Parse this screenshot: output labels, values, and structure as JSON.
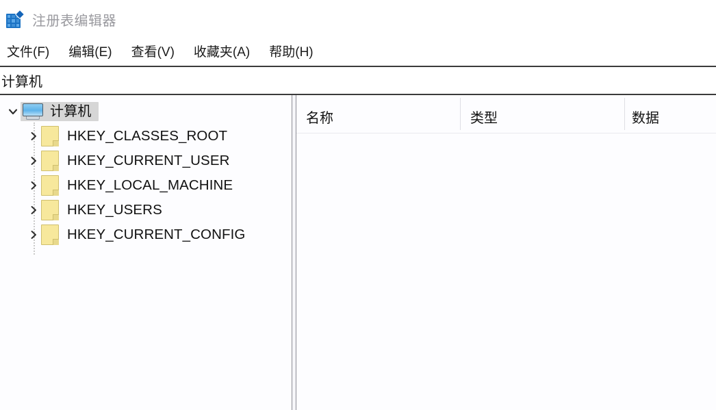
{
  "window": {
    "title": "注册表编辑器",
    "app_icon": "registry-grid-icon"
  },
  "menubar": {
    "items": [
      {
        "label": "文件(F)"
      },
      {
        "label": "编辑(E)"
      },
      {
        "label": "查看(V)"
      },
      {
        "label": "收藏夹(A)"
      },
      {
        "label": "帮助(H)"
      }
    ]
  },
  "address_bar": {
    "path": "计算机"
  },
  "tree": {
    "root": {
      "label": "计算机",
      "icon": "monitor-icon",
      "expanded": true,
      "selected": true,
      "chevron": "chevron-down-icon"
    },
    "children": [
      {
        "label": "HKEY_CLASSES_ROOT",
        "icon": "folder-icon",
        "chevron": "chevron-right-icon",
        "expanded": false
      },
      {
        "label": "HKEY_CURRENT_USER",
        "icon": "folder-icon",
        "chevron": "chevron-right-icon",
        "expanded": false
      },
      {
        "label": "HKEY_LOCAL_MACHINE",
        "icon": "folder-icon",
        "chevron": "chevron-right-icon",
        "expanded": false
      },
      {
        "label": "HKEY_USERS",
        "icon": "folder-icon",
        "chevron": "chevron-right-icon",
        "expanded": false
      },
      {
        "label": "HKEY_CURRENT_CONFIG",
        "icon": "folder-icon",
        "chevron": "chevron-right-icon",
        "expanded": false
      }
    ]
  },
  "value_list": {
    "columns": [
      {
        "label": "名称"
      },
      {
        "label": "类型"
      },
      {
        "label": "数据"
      }
    ],
    "rows": []
  },
  "colors": {
    "title_text": "#9a9a9f",
    "menu_text": "#1b1b1b",
    "selection": "#d6d6d6",
    "folder": "#f7e89c",
    "monitor_screen": "#5eb3ea",
    "app_icon": "#1c73c4",
    "rule": "#3b3b3b",
    "pane_background": "#fdfdff"
  }
}
